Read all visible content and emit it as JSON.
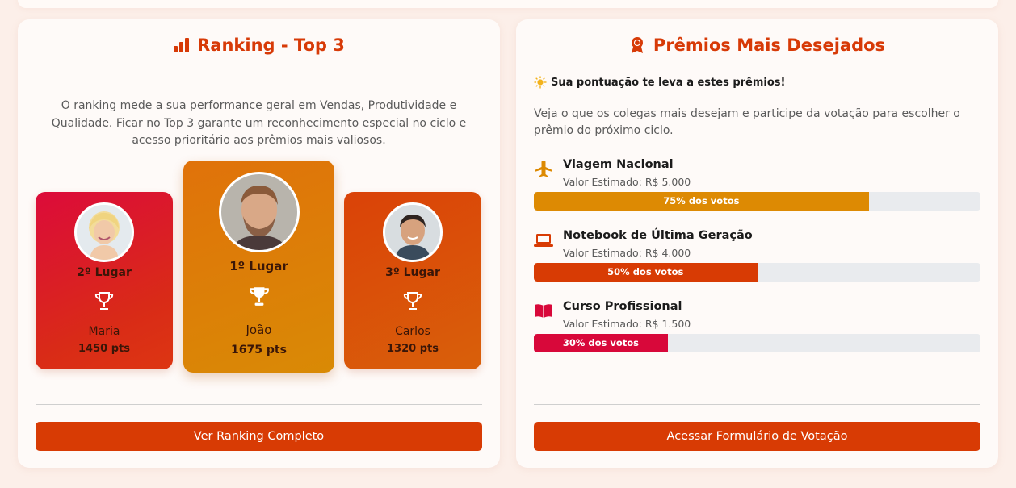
{
  "ranking": {
    "title": "Ranking - Top 3",
    "intro": "O ranking mede a sua performance geral em Vendas, Produtividade e Qualidade. Ficar no Top 3 garante um reconhecimento especial no ciclo e acesso prioritário aos prêmios mais valiosos.",
    "podium": [
      {
        "place": "2º Lugar",
        "name": "Maria",
        "points": "1450 pts"
      },
      {
        "place": "1º Lugar",
        "name": "João",
        "points": "1675 pts"
      },
      {
        "place": "3º Lugar",
        "name": "Carlos",
        "points": "1320 pts"
      }
    ],
    "button_label": "Ver Ranking Completo"
  },
  "prizes": {
    "title": "Prêmios Mais Desejados",
    "subheading": "Sua pontuação te leva a estes prêmios!",
    "description": "Veja o que os colegas mais desejam e participe da votação para escolher o prêmio do próximo ciclo.",
    "items": [
      {
        "name": "Viagem Nacional",
        "value": "Valor Estimado: R$ 5.000",
        "votes_label": "75% dos votos",
        "votes_pct": 75,
        "color": "#dd8a03",
        "icon": "airplane-icon"
      },
      {
        "name": "Notebook de Última Geração",
        "value": "Valor Estimado: R$ 4.000",
        "votes_label": "50% dos votos",
        "votes_pct": 50,
        "color": "#d83b04",
        "icon": "laptop-icon"
      },
      {
        "name": "Curso Profissional",
        "value": "Valor Estimado: R$ 1.500",
        "votes_label": "30% dos votos",
        "votes_pct": 30,
        "color": "#d8083a",
        "icon": "book-icon"
      }
    ],
    "button_label": "Acessar Formulário de Votação"
  },
  "colors": {
    "accent": "#d83b04",
    "background": "#fcefe9"
  }
}
